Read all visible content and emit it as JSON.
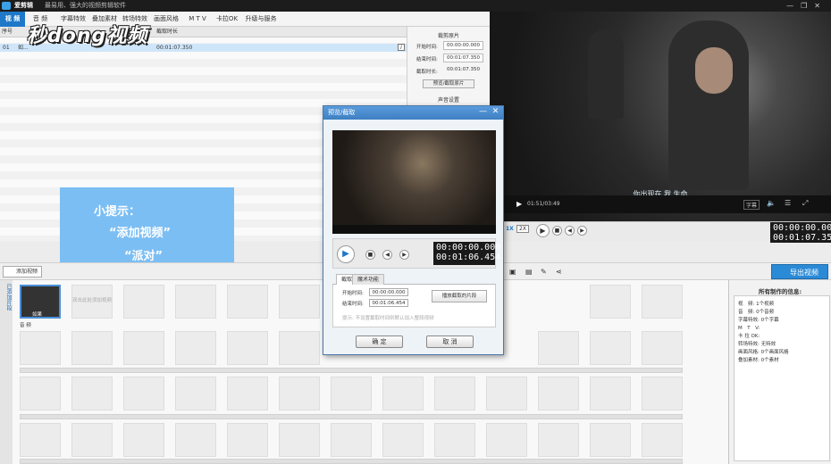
{
  "app": {
    "name": "爱剪辑",
    "slogan": "最易用、强大的视频剪辑软件",
    "window_controls": [
      "—",
      "❐",
      "✕"
    ]
  },
  "menu": {
    "tabs": [
      "视 频",
      "音 频",
      "字幕特效",
      "叠加素材",
      "转场特效",
      "画面风格",
      "M T V",
      "卡拉OK",
      "升级与服务"
    ]
  },
  "clip_list": {
    "headers": [
      "序号",
      "截取时长"
    ],
    "row": {
      "index": "01",
      "name": "如...",
      "duration": "00:01:07.350",
      "info_icon": "i"
    }
  },
  "clip_settings": {
    "section_title": "裁剪原片",
    "fields": [
      {
        "label": "开始时间:",
        "value": "00:00:00.000"
      },
      {
        "label": "结束时间:",
        "value": "00:01:07.350"
      },
      {
        "label": "截取时长:",
        "value": "00:01:07.350"
      }
    ],
    "preview_button": "预览/截取原片",
    "sound_section_title": "声音设置"
  },
  "video_preview": {
    "subtitle": "你出现在 我 生命",
    "time": "01:51/03:49",
    "speed_1x": "1X",
    "speed_2x": "2X",
    "time_current": "00:00:00.000",
    "time_total": "00:01:07.350"
  },
  "tip": {
    "title": "小提示：",
    "line1": "“添加视频”",
    "line2": "“派对”"
  },
  "watermark": {
    "text": "秒dong视频"
  },
  "toolbar": {
    "add_video": "添加视频",
    "export": "导出视频"
  },
  "timeline": {
    "side_label": "已添加片段",
    "first_clip_label": "如果",
    "placeholder_text": "双击此处添加视频",
    "audio_label": "音 频"
  },
  "info_panel": {
    "title": "所有制作的信息:",
    "rows": [
      {
        "label": "视　频:",
        "value": "1个视频"
      },
      {
        "label": "音　频:",
        "value": "0个音频"
      },
      {
        "label": "字幕特效:",
        "value": "0个字幕"
      },
      {
        "label": "M　T　V:",
        "value": ""
      },
      {
        "label": "卡 拉 OK:",
        "value": ""
      },
      {
        "label": "转场特效:",
        "value": "无特效"
      },
      {
        "label": "画面风格:",
        "value": "0个画面风格"
      },
      {
        "label": "叠加素材:",
        "value": "0个素材"
      }
    ]
  },
  "dialog": {
    "title": "预览/截取",
    "time_current": "00:00:00.000",
    "time_total": "00:01:06.454",
    "tabs": [
      "截取",
      "魔术功能"
    ],
    "start_label": "开始时间:",
    "start_value": "00:00:00.000",
    "end_label": "结束时间:",
    "end_value": "00:01:06.454",
    "play_clip_button": "播放截取的片段",
    "hint": "提示: 不设置截取时间则默认加入整段视频",
    "ok_button": "确 定",
    "cancel_button": "取 消"
  },
  "colors": {
    "accent": "#1f78c8",
    "tip_bg": "#7bbef3",
    "export": "#2b8ad6"
  }
}
